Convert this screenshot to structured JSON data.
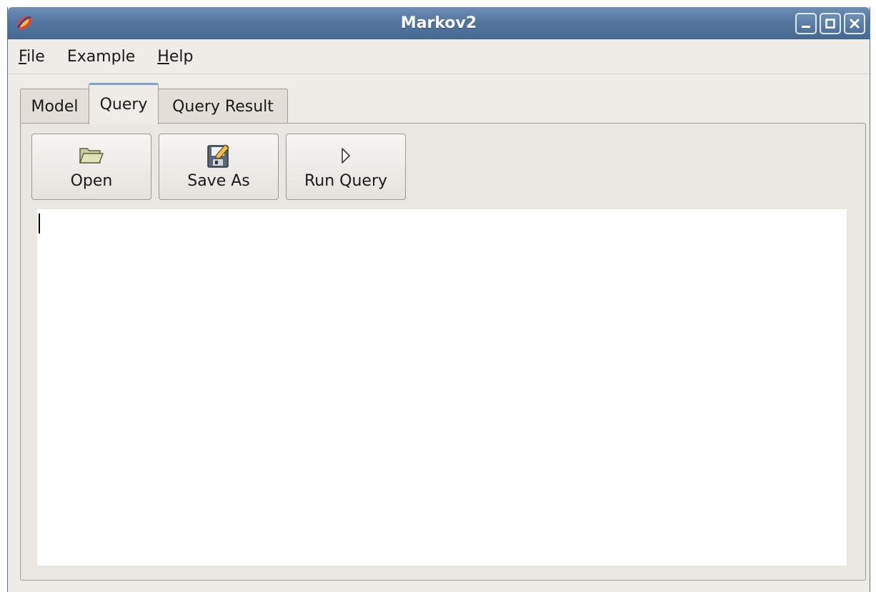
{
  "window": {
    "title": "Markov2",
    "accent_color": "#55779f",
    "buttons": [
      "minimize-icon",
      "maximize-icon",
      "close-icon"
    ]
  },
  "menubar": {
    "items": [
      {
        "mnemonic": "F",
        "rest": "ile"
      },
      {
        "label": "Example"
      },
      {
        "mnemonic": "H",
        "rest": "elp"
      }
    ]
  },
  "tabs": [
    {
      "label": "Model",
      "active": false
    },
    {
      "label": "Query",
      "active": true
    },
    {
      "label": "Query Result",
      "active": false
    }
  ],
  "toolbar": {
    "open_label": "Open",
    "save_as_label": "Save As",
    "run_query_label": "Run Query",
    "icons": [
      "folder-open-icon",
      "save-as-icon",
      "run-arrow-icon"
    ]
  },
  "editor": {
    "value": ""
  }
}
